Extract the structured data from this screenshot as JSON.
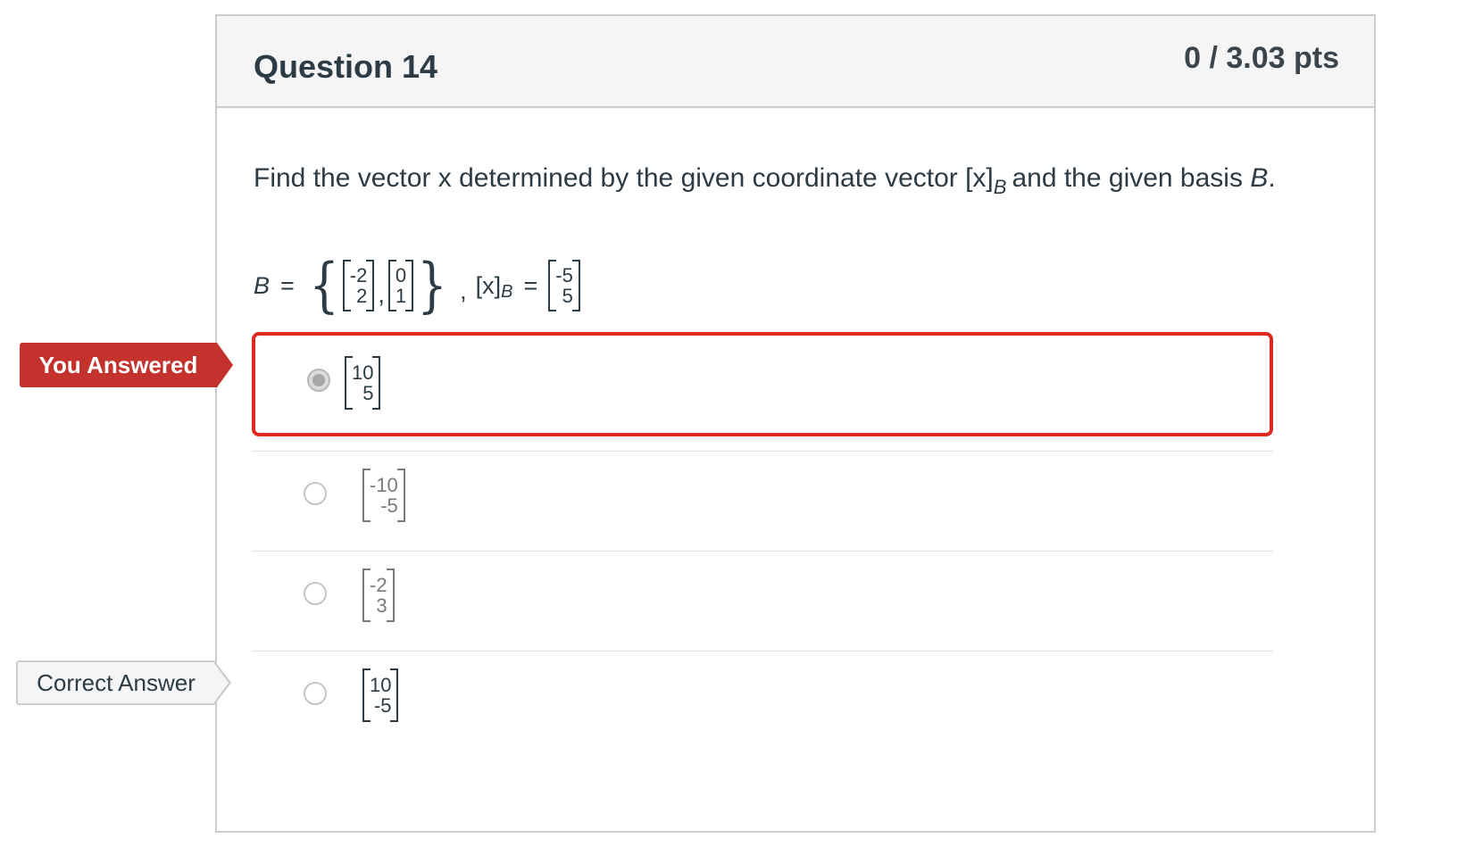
{
  "question": {
    "title": "Question 14",
    "points": "0 / 3.03 pts",
    "prompt_part1": "Find the vector x determined by the given coordinate vector [x]",
    "prompt_sub": "B",
    "prompt_part2": "and the given basis ",
    "prompt_basis": "B",
    "prompt_end": "."
  },
  "formula": {
    "b_label": "B",
    "equals": "=",
    "open_brace": "{",
    "close_brace": "}",
    "basis_v1": [
      "-2",
      "2"
    ],
    "basis_v2": [
      "0",
      "1"
    ],
    "comma": ",",
    "coord_label": "[x]",
    "coord_sub": "B",
    "coord_equals": "=",
    "coord_vec": [
      "-5",
      "5"
    ]
  },
  "answers": [
    {
      "vec": [
        "10",
        "5"
      ],
      "selected": true
    },
    {
      "vec": [
        "-10",
        "-5"
      ],
      "selected": false
    },
    {
      "vec": [
        "-2",
        "3"
      ],
      "selected": false
    },
    {
      "vec": [
        "10",
        "-5"
      ],
      "selected": false
    }
  ],
  "tags": {
    "you_answered": "You Answered",
    "correct_answer": "Correct Answer"
  },
  "colors": {
    "incorrect": "#c3322c",
    "selected_border": "#e0291e",
    "border": "#c7cdd1",
    "header_bg": "#f5f5f5"
  }
}
